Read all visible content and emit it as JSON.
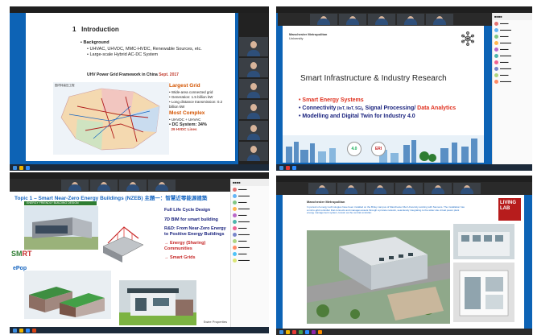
{
  "slide1": {
    "number": "1",
    "title": "Introduction",
    "bullets": [
      "Background",
      "UHVAC, UHVDC, MMC-HVDC, Renewable Sources, etc.",
      "Large-scale Hybrid AC-DC System"
    ],
    "subtitle": "UHV Power Grid Framework in China",
    "subtitle_date": "Sept. 2017",
    "map_title": "国内特高压工程",
    "largest_grid_heading": "Largest Grid",
    "largest_grid_items": [
      "Wide-area connected grid",
      "Generation: 1.5 billion kW",
      "Long distance transmission: 0.2 billion kW"
    ],
    "most_complex_heading": "Most Complex",
    "most_complex_item": "UHVDC + UHVAC",
    "dc_system": "DC System: 34%",
    "hvdc_lines": "29 HVDC Lines",
    "participants": [
      "",
      "",
      "",
      "",
      "",
      "",
      ""
    ]
  },
  "slide2": {
    "university": [
      "Manchester Metropolitan",
      "University"
    ],
    "heading": "Smart Infrastructure & Industry Research",
    "items": [
      {
        "text": "Smart Energy Systems",
        "style": "red"
      },
      {
        "text": "Connectivity",
        "suffix": " (IoT, IIoT, 5G)",
        "tail": ", Signal Processing/",
        "tail2": " Data Analytics"
      },
      {
        "text": "Modelling and Digital Twin for Industry 4.0",
        "style": "navy"
      }
    ],
    "badge_4": "4.0",
    "badge_eri": "ERI"
  },
  "slide3": {
    "title": "Topic 1 – Smart Near-Zero Energy Buildings (NZEB) 主題一：智慧近零能源建築",
    "banner": "ENERGY FRIENDLY BUILDING DESIGN",
    "logo_smart_a": "SM",
    "logo_smart_b": "RT",
    "logo_epop": "ePop",
    "points": [
      {
        "text": "Full Life Cycle Design"
      },
      {
        "text": "7D BIM for smart building"
      },
      {
        "text": "R&D: From Near-Zero Energy to Positive Energy Buildings"
      },
      {
        "text": "→ Energy (Sharing) Communities",
        "style": "red"
      },
      {
        "text": "→ Smart Grids",
        "style": "red"
      }
    ],
    "sponsor": "Swire Properties"
  },
  "slide4": {
    "university": "Manchester Metropolitan",
    "paragraph": "In pursuit of energy technologies have been installed on the Birley campus of Manchester Met University working with Siemens. The installation has a micro-grid controller that connects and manages assets through a private network, seamlessly integrating to the wider site virtual power plant energy management system, known as the central controller.",
    "living_lab": [
      "LIVING",
      "LAB"
    ]
  },
  "colors": {
    "frame_blue": "#0d63b5",
    "accent_red": "#e0301e",
    "navy": "#1a237e",
    "green": "#2e7d32"
  }
}
